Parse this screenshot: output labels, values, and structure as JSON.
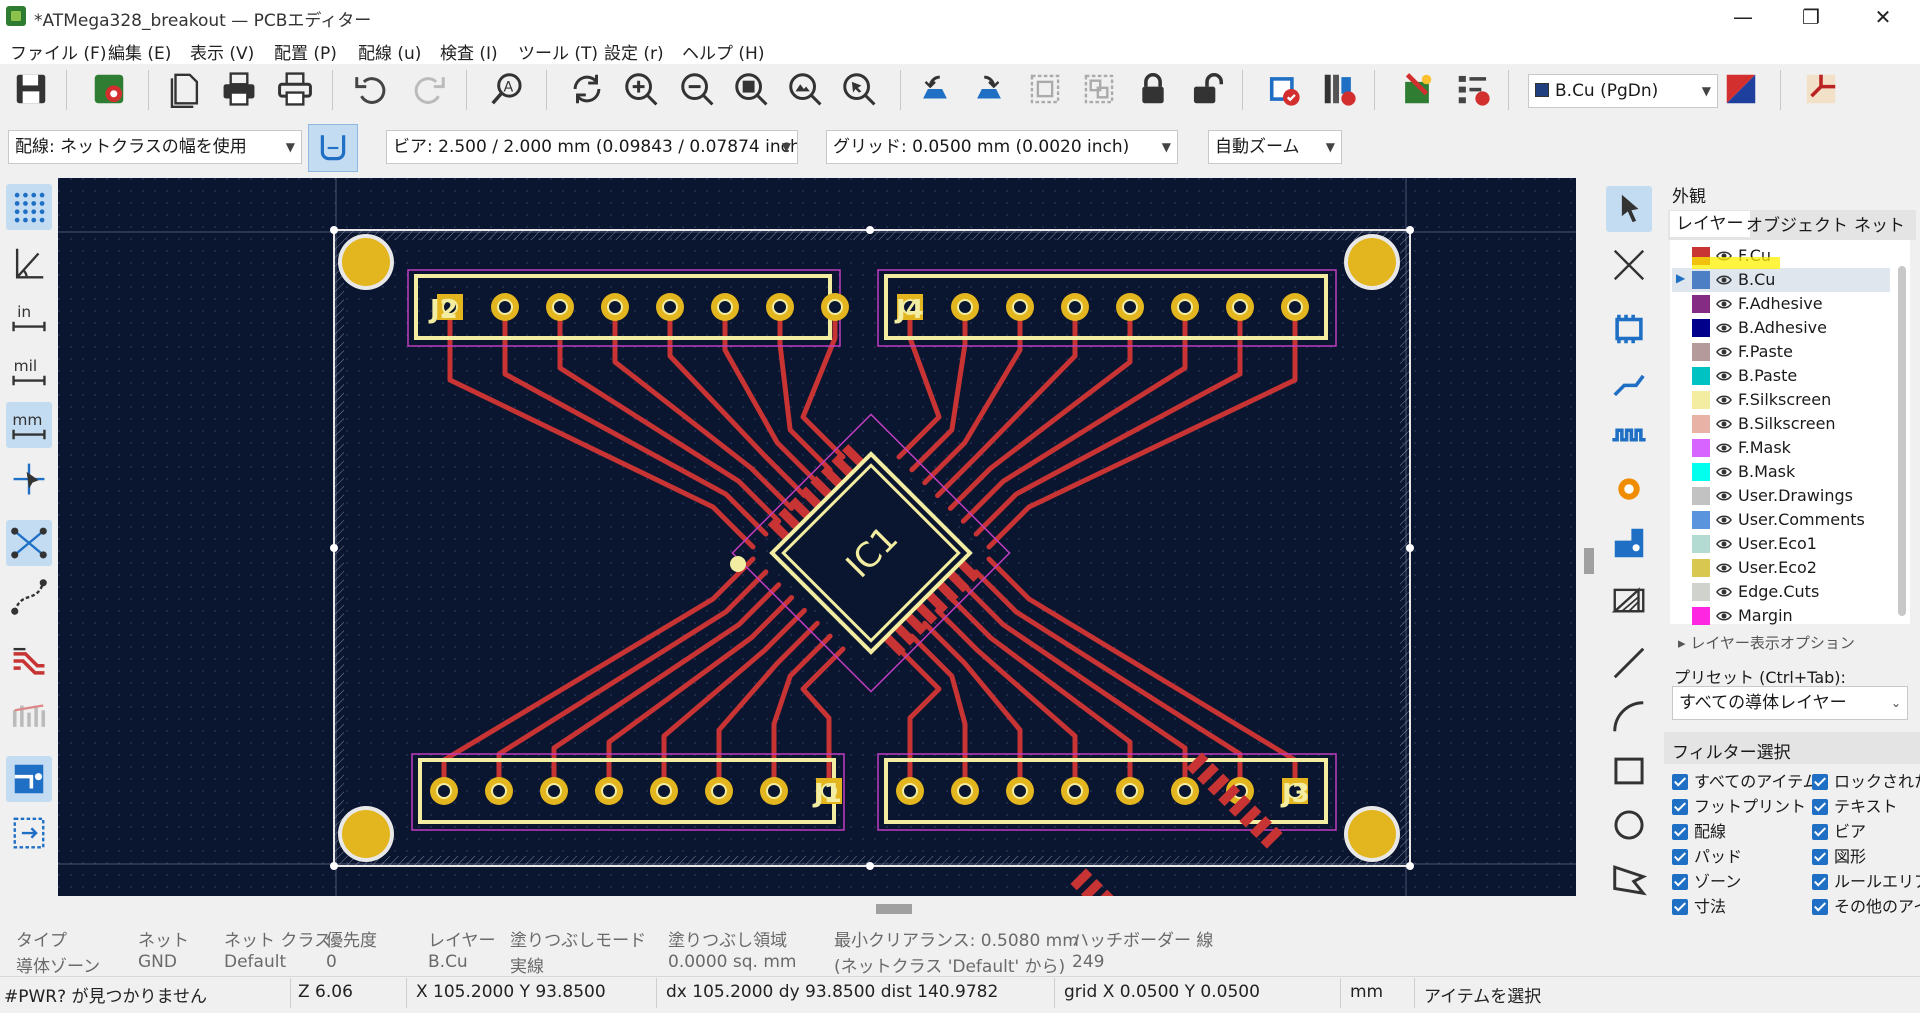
{
  "window": {
    "title": "*ATMega328_breakout — PCBエディター",
    "minimize": "—",
    "maximize": "❐",
    "close": "✕"
  },
  "menu": [
    "ファイル (F)",
    "編集 (E)",
    "表示 (V)",
    "配置 (P)",
    "配線 (u)",
    "検査 (I)",
    "ツール (T)",
    "設定 (r)",
    "ヘルプ (H)"
  ],
  "toolbar": {
    "layer_select": "B.Cu (PgDn)",
    "track_width": "配線: ネットクラスの幅を使用",
    "via_size": "ビア: 2.500 / 2.000 mm (0.09843 / 0.07874 inch)",
    "grid": "グリッド: 0.0500 mm (0.0020 inch)",
    "zoom": "自動ズーム"
  },
  "board": {
    "refs": [
      "J2",
      "J4",
      "J1",
      "J3"
    ],
    "ic_label": "IC1"
  },
  "panel": {
    "title": "外観",
    "tabs": [
      "レイヤー",
      "オブジェクト",
      "ネット"
    ],
    "layers": [
      {
        "name": "F.Cu",
        "color": "#c83434"
      },
      {
        "name": "B.Cu",
        "color": "#4d7fc4"
      },
      {
        "name": "F.Adhesive",
        "color": "#842b84"
      },
      {
        "name": "B.Adhesive",
        "color": "#00008b"
      },
      {
        "name": "F.Paste",
        "color": "#b49a9a"
      },
      {
        "name": "B.Paste",
        "color": "#00c2c2"
      },
      {
        "name": "F.Silkscreen",
        "color": "#f2eda1"
      },
      {
        "name": "B.Silkscreen",
        "color": "#e8b2a7"
      },
      {
        "name": "F.Mask",
        "color": "#d864ff"
      },
      {
        "name": "B.Mask",
        "color": "#02ffee"
      },
      {
        "name": "User.Drawings",
        "color": "#c2c2c2"
      },
      {
        "name": "User.Comments",
        "color": "#5994dc"
      },
      {
        "name": "User.Eco1",
        "color": "#b4dbd2"
      },
      {
        "name": "User.Eco2",
        "color": "#d8c852"
      },
      {
        "name": "Edge.Cuts",
        "color": "#d0d2cd"
      },
      {
        "name": "Margin",
        "color": "#ff26e2"
      }
    ],
    "layer_display_options": "レイヤー表示オプション",
    "preset_label": "プリセット (Ctrl+Tab):",
    "preset_value": "すべての導体レイヤー",
    "filter_title": "フィルター選択",
    "filters_left": [
      "すべてのアイテム",
      "フットプリント",
      "配線",
      "パッド",
      "ゾーン",
      "寸法"
    ],
    "filters_right": [
      "ロックされたア",
      "テキスト",
      "ビア",
      "図形",
      "ルールエリア",
      "その他のアイテ"
    ]
  },
  "message_panel": {
    "items": [
      {
        "label": "タイプ",
        "value": "導体ゾーン"
      },
      {
        "label": "ネット",
        "value": "GND"
      },
      {
        "label": "ネット クラス",
        "value": "Default"
      },
      {
        "label": "優先度",
        "value": "0"
      },
      {
        "label": "レイヤー",
        "value": "B.Cu"
      },
      {
        "label": "塗りつぶしモード",
        "value": "実線"
      },
      {
        "label": "塗りつぶし領域",
        "value": "0.0000 sq. mm"
      },
      {
        "label": "最小クリアランス: 0.5080 mm",
        "value": "(ネットクラス 'Default' から)"
      },
      {
        "label": "ハッチボーダー 線",
        "value": "249"
      }
    ]
  },
  "status": {
    "message": "#PWR? が見つかりません",
    "zoom": "Z 6.06",
    "xy": "X 105.2000  Y 93.8500",
    "delta": "dx 105.2000  dy 93.8500  dist 140.9782",
    "grid": "grid X 0.0500  Y 0.0500",
    "units": "mm",
    "mode": "アイテムを選択"
  },
  "colors": {
    "canvas_bg": "#0a1530",
    "track": "#c83434",
    "pad": "#d8b400",
    "silk": "#f2eda1",
    "courtyard": "#c03cc0",
    "selection": "#1f6fc5"
  }
}
